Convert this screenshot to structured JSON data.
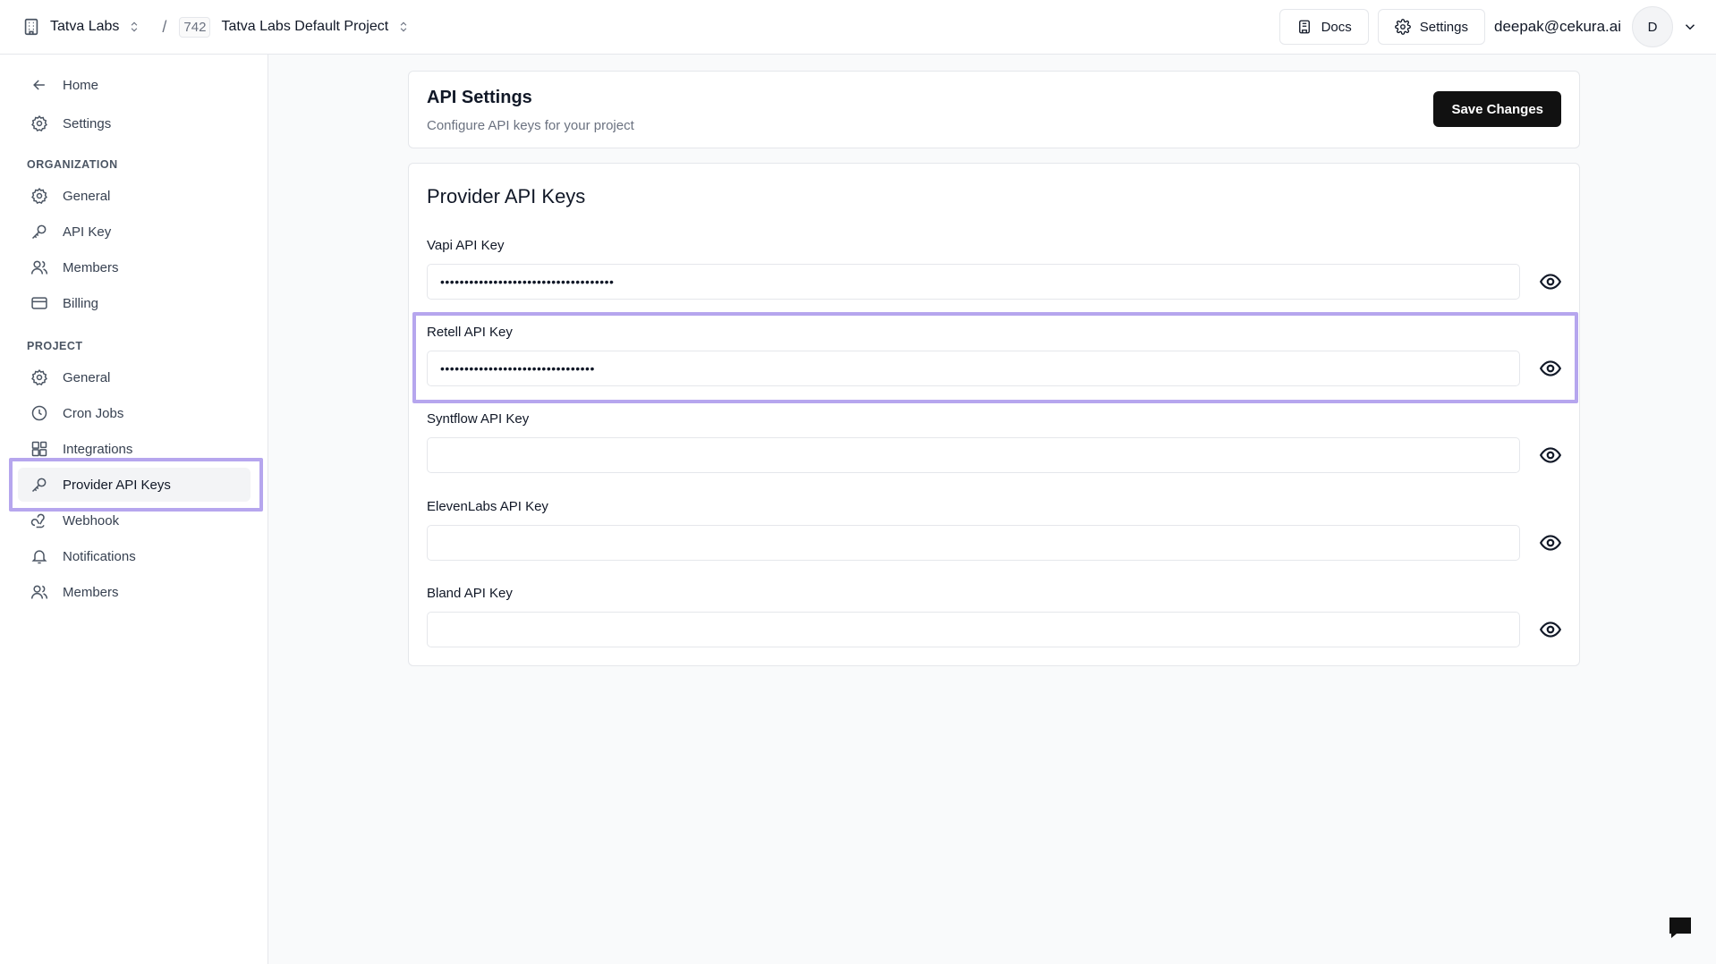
{
  "topbar": {
    "org_name": "Tatva Labs",
    "separator": "/",
    "project_id": "742",
    "project_name": "Tatva Labs Default Project",
    "docs_label": "Docs",
    "settings_label": "Settings",
    "user_email": "deepak@cekura.ai",
    "avatar_initial": "D"
  },
  "sidebar": {
    "top_items": [
      {
        "label": "Home",
        "icon": "arrow-left-icon"
      },
      {
        "label": "Settings",
        "icon": "gear-icon"
      }
    ],
    "organization_label": "ORGANIZATION",
    "organization_items": [
      {
        "label": "General",
        "icon": "gear-icon"
      },
      {
        "label": "API Key",
        "icon": "key-icon"
      },
      {
        "label": "Members",
        "icon": "users-icon"
      },
      {
        "label": "Billing",
        "icon": "credit-card-icon"
      }
    ],
    "project_label": "PROJECT",
    "project_items": [
      {
        "label": "General",
        "icon": "gear-icon"
      },
      {
        "label": "Cron Jobs",
        "icon": "clock-icon"
      },
      {
        "label": "Integrations",
        "icon": "blocks-icon"
      },
      {
        "label": "Provider API Keys",
        "icon": "key-icon",
        "active": true
      },
      {
        "label": "Webhook",
        "icon": "webhook-icon"
      },
      {
        "label": "Notifications",
        "icon": "bell-icon"
      },
      {
        "label": "Members",
        "icon": "users-icon"
      }
    ]
  },
  "api_settings": {
    "title": "API Settings",
    "subtitle": "Configure API keys for your project",
    "save_label": "Save Changes"
  },
  "provider_keys": {
    "title": "Provider API Keys",
    "fields": [
      {
        "label": "Vapi API Key",
        "value": "••••••••••••••••••••••••••••••••••••"
      },
      {
        "label": "Retell API Key",
        "value": "••••••••••••••••••••••••••••••••"
      },
      {
        "label": "Syntflow API Key",
        "value": ""
      },
      {
        "label": "ElevenLabs API Key",
        "value": ""
      },
      {
        "label": "Bland API Key",
        "value": ""
      }
    ]
  },
  "colors": {
    "highlight": "#b6a6ee",
    "primary_button": "#111111",
    "active_nav": "#f3f4f6"
  }
}
